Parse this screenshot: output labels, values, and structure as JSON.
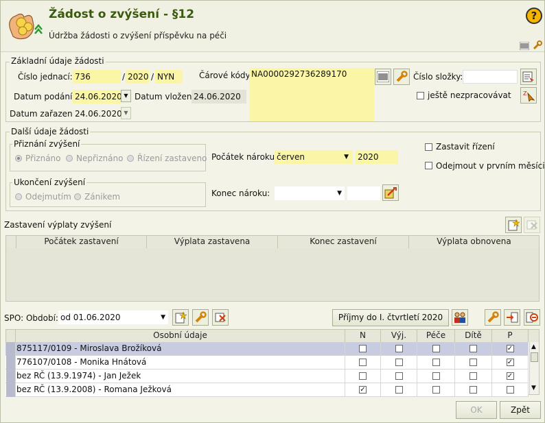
{
  "header": {
    "title": "Žádost o zvýšení - §12",
    "subtitle": "Údržba žádosti o zvýšení příspěvku na péči",
    "help_icon": "question-icon",
    "help_glyph": "?"
  },
  "basic": {
    "legend": "Základní údaje žádosti",
    "cislo_jednaci_label": "Číslo jednací:",
    "cislo_jednaci": "736",
    "sep1": "/",
    "year": "2020",
    "sep2": "/",
    "suffix": "NYN",
    "datum_podani_label": "Datum podání:",
    "datum_podani": "24.06.2020",
    "datum_vlozeni_label": "Datum vložení:",
    "datum_vlozeni": "24.06.2020",
    "datum_zarazeni_label": "Datum zařazení:",
    "datum_zarazeni": "24.06.2020",
    "carove_kody_label": "Čárové kódy:",
    "carove_kody": "NA0000292736289170",
    "cislo_slozky_label": "Číslo složky:",
    "cislo_slozky": "",
    "nezpracovavat_label": "ještě nezpracovávat",
    "nezpracovavat_checked": false
  },
  "other": {
    "legend": "Další údaje žádosti",
    "priznani_legend": "Přiznání zvýšení",
    "priznano": "Přiznáno",
    "nepriznano": "Nepřiznáno",
    "rizeni_zastaveno": "Řízení zastaveno",
    "ukonceni_legend": "Ukončení zvýšení",
    "odejmutim": "Odejmutím",
    "zanikem": "Zánikem",
    "pocatek_label": "Počátek nároku:",
    "pocatek_mesic": "červen",
    "pocatek_rok": "2020",
    "konec_label": "Konec nároku:",
    "konec_mesic": "",
    "konec_rok": "",
    "zastavit_label": "Zastavit řízení",
    "zastavit_checked": false,
    "odejmout_label": "Odejmout v prvním měsíci",
    "odejmout_checked": false
  },
  "suspension": {
    "title": "Zastavení výplaty zvýšení",
    "columns": [
      "Počátek zastavení",
      "Výplata zastavena",
      "Konec zastavení",
      "Výplata obnovena"
    ]
  },
  "spo": {
    "label": "SPO: Období:",
    "period": "od 01.06.2020",
    "income_button": "Příjmy do I. čtvrtletí 2020"
  },
  "persons": {
    "columns": [
      "Osobní údaje",
      "N",
      "Výj.",
      "Péče",
      "Dítě",
      "P"
    ],
    "rows": [
      {
        "name": "875117/0109 - Miroslava Brožíková",
        "n": false,
        "vyj": false,
        "pece": false,
        "dite": false,
        "p": true
      },
      {
        "name": "776107/0108 - Monika Hnátová",
        "n": false,
        "vyj": false,
        "pece": false,
        "dite": false,
        "p": true
      },
      {
        "name": "bez RČ (13.9.1974) - Jan Ježek",
        "n": false,
        "vyj": false,
        "pece": false,
        "dite": false,
        "p": true
      },
      {
        "name": "bez RČ (13.9.2008) - Romana Ježková",
        "n": true,
        "vyj": false,
        "pece": false,
        "dite": false,
        "p": false
      }
    ]
  },
  "footer": {
    "ok_label": "OK",
    "back_label": "Zpět"
  },
  "colors": {
    "title": "#3a5a10",
    "required_field": "#fbf6a6",
    "selected_row": "#c8cce0"
  }
}
